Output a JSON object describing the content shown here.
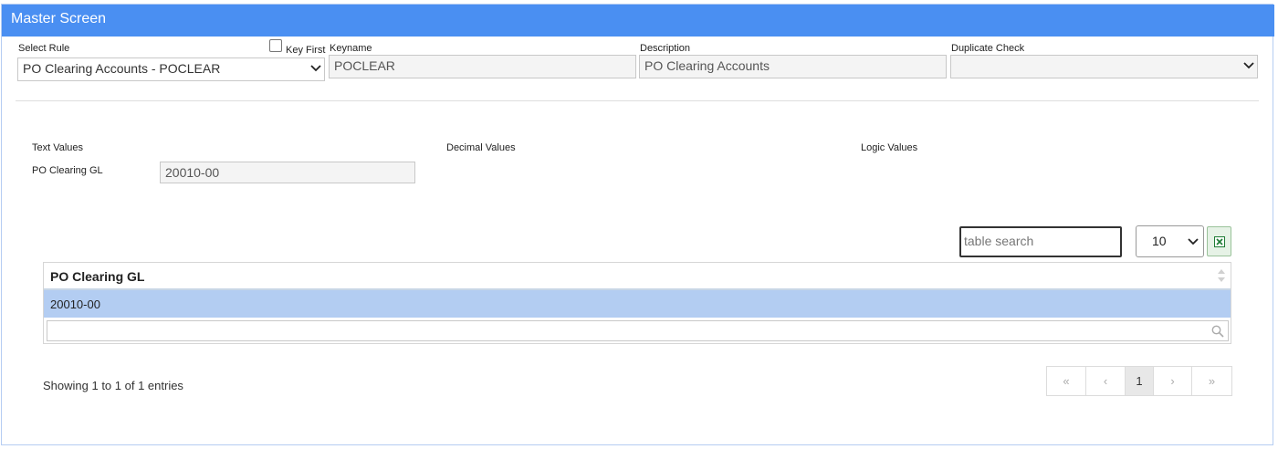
{
  "header": {
    "title": "Master Screen"
  },
  "form": {
    "select_rule": {
      "label": "Select Rule",
      "value": "PO Clearing Accounts - POCLEAR"
    },
    "key_first": {
      "label": "Key First",
      "checked": false
    },
    "keyname": {
      "label": "Keyname",
      "value": "POCLEAR"
    },
    "description": {
      "label": "Description",
      "value": "PO Clearing Accounts"
    },
    "duplicate_check": {
      "label": "Duplicate Check",
      "value": ""
    }
  },
  "values_section": {
    "text_values_label": "Text Values",
    "decimal_values_label": "Decimal Values",
    "logic_values_label": "Logic Values",
    "po_clearing_gl": {
      "label": "PO Clearing GL",
      "value": "20010-00"
    }
  },
  "table_controls": {
    "search_placeholder": "table search",
    "page_size": "10",
    "page_size_options": [
      "10"
    ]
  },
  "table": {
    "columns": [
      "PO Clearing GL"
    ],
    "rows": [
      [
        "20010-00"
      ]
    ],
    "column_filter_placeholder": ""
  },
  "footer": {
    "info": "Showing 1 to 1 of 1 entries",
    "pagination": {
      "first": "«",
      "prev": "‹",
      "current_page": "1",
      "next": "›",
      "last": "»"
    }
  },
  "colors": {
    "header_bg": "#4a8ff2",
    "selected_row_bg": "#b3cdf2",
    "excel_green": "#1e7b34"
  },
  "icons": {
    "chevron": "chevron-down-icon",
    "sort": "sort-icon",
    "search": "search-icon",
    "excel": "excel-icon"
  }
}
